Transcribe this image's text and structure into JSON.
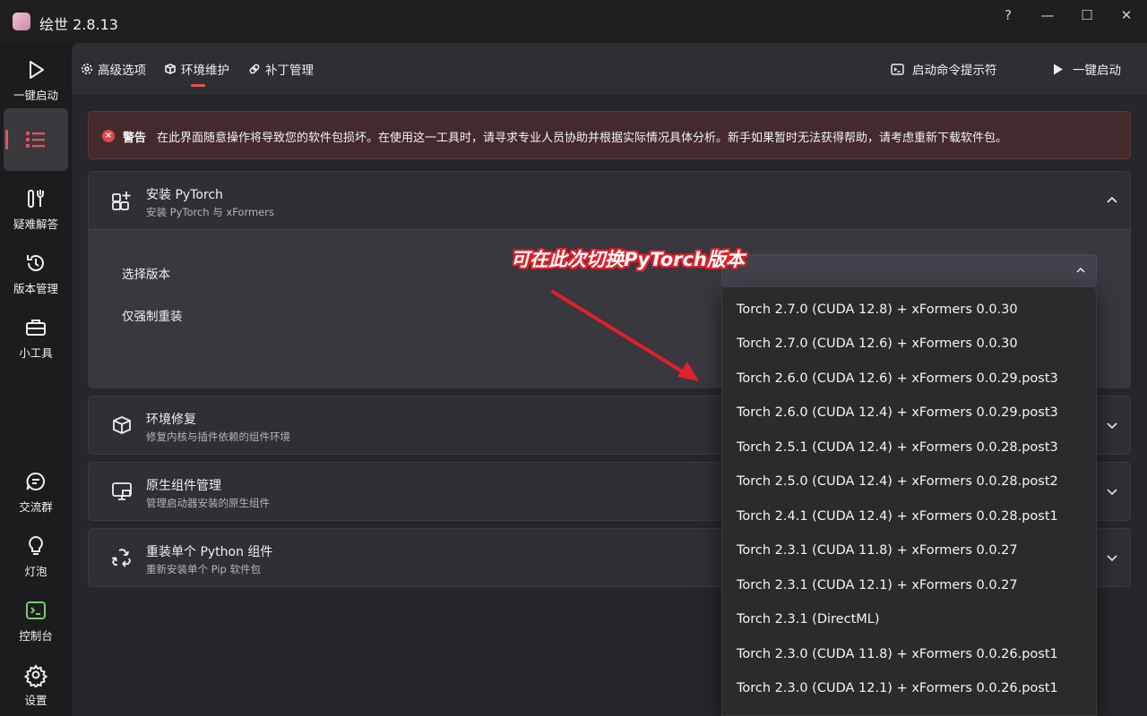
{
  "window": {
    "title": "绘世 2.8.13",
    "help_label": "?",
    "minimize_label": "—",
    "maximize_label": "☐",
    "close_label": "✕"
  },
  "sidebar": {
    "items": [
      {
        "label": "一键启动",
        "icon": "play-icon"
      },
      {
        "label": "",
        "icon": "list-icon",
        "active": true
      },
      {
        "label": "疑难解答",
        "icon": "tools-icon"
      },
      {
        "label": "版本管理",
        "icon": "history-icon"
      },
      {
        "label": "小工具",
        "icon": "toolbox-icon"
      },
      {
        "label": "交流群",
        "icon": "chat-icon"
      },
      {
        "label": "灯泡",
        "icon": "bulb-icon"
      },
      {
        "label": "控制台",
        "icon": "console-icon"
      },
      {
        "label": "设置",
        "icon": "gear-icon"
      }
    ]
  },
  "topbar": {
    "tabs": [
      {
        "label": "高级选项",
        "icon": "gear-icon"
      },
      {
        "label": "环境维护",
        "icon": "package-icon",
        "active": true
      },
      {
        "label": "补丁管理",
        "icon": "bandage-icon"
      }
    ],
    "cmd_label": "启动命令提示符",
    "launch_label": "一键启动"
  },
  "warning": {
    "title": "警告",
    "text": "在此界面随意操作将导致您的软件包损坏。在使用这一工具时，请寻求专业人员协助并根据实际情况具体分析。新手如果暂时无法获得帮助，请考虑重新下载软件包。"
  },
  "cards": [
    {
      "title": "安装 PyTorch",
      "subtitle": "安装 PyTorch 与 xFormers",
      "expanded": true
    },
    {
      "title": "环境修复",
      "subtitle": "修复内核与插件依赖的组件环境",
      "expanded": false
    },
    {
      "title": "原生组件管理",
      "subtitle": "管理启动器安装的原生组件",
      "expanded": false
    },
    {
      "title": "重装单个 Python 组件",
      "subtitle": "重新安装单个 Pip 软件包",
      "expanded": false
    }
  ],
  "pytorch": {
    "version_label": "选择版本",
    "force_label": "仅强制重装",
    "selected_value": ""
  },
  "dropdown": {
    "options": [
      "Torch 2.7.0 (CUDA 12.8) + xFormers 0.0.30",
      "Torch 2.7.0 (CUDA 12.6) + xFormers 0.0.30",
      "Torch 2.6.0 (CUDA 12.6) + xFormers 0.0.29.post3",
      "Torch 2.6.0 (CUDA 12.4) + xFormers 0.0.29.post3",
      "Torch 2.5.1 (CUDA 12.4) + xFormers 0.0.28.post3",
      "Torch 2.5.0 (CUDA 12.4) + xFormers 0.0.28.post2",
      "Torch 2.4.1 (CUDA 12.4) + xFormers 0.0.28.post1",
      "Torch 2.3.1 (CUDA 11.8) + xFormers 0.0.27",
      "Torch 2.3.1 (CUDA 12.1) + xFormers 0.0.27",
      "Torch 2.3.1 (DirectML)",
      "Torch 2.3.0 (CUDA 11.8) + xFormers 0.0.26.post1",
      "Torch 2.3.0 (CUDA 12.1) + xFormers 0.0.26.post1"
    ]
  },
  "annotation": {
    "text": "可在此次切换PyTorch版本",
    "color": "#e0202a"
  },
  "colors": {
    "accent": "#e05562",
    "warning_bg": "#442a2d",
    "console_icon": "#7bc96f"
  }
}
